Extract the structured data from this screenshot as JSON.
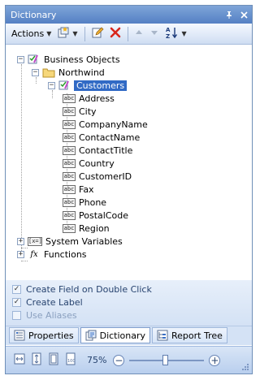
{
  "window": {
    "title": "Dictionary",
    "pin_icon": "pin-icon",
    "close_icon": "close-icon"
  },
  "toolbar": {
    "actions_label": "Actions"
  },
  "tree": {
    "root": {
      "label": "Business Objects"
    },
    "datasource": {
      "label": "Northwind"
    },
    "table": {
      "label": "Customers"
    },
    "fields": [
      {
        "label": "Address"
      },
      {
        "label": "City"
      },
      {
        "label": "CompanyName"
      },
      {
        "label": "ContactName"
      },
      {
        "label": "ContactTitle"
      },
      {
        "label": "Country"
      },
      {
        "label": "CustomerID"
      },
      {
        "label": "Fax"
      },
      {
        "label": "Phone"
      },
      {
        "label": "PostalCode"
      },
      {
        "label": "Region"
      }
    ],
    "field_type_badge": "abc",
    "system_variables": {
      "label": "System Variables",
      "badge": "[x=]"
    },
    "functions": {
      "label": "Functions",
      "badge": "fx"
    }
  },
  "options": [
    {
      "label": "Create Field on Double Click",
      "checked": true,
      "enabled": true
    },
    {
      "label": "Create Label",
      "checked": true,
      "enabled": true
    },
    {
      "label": "Use Aliases",
      "checked": false,
      "enabled": false
    }
  ],
  "tabs": [
    {
      "label": "Properties",
      "active": false
    },
    {
      "label": "Dictionary",
      "active": true
    },
    {
      "label": "Report Tree",
      "active": false
    }
  ],
  "statusbar": {
    "zoom_label": "75%",
    "zoom_minus": "−",
    "zoom_plus": "+",
    "zoom_level": 0.48
  },
  "colors": {
    "title_bar": "#5a86c9",
    "selection": "#316ac5",
    "option_text": "#27436f"
  }
}
